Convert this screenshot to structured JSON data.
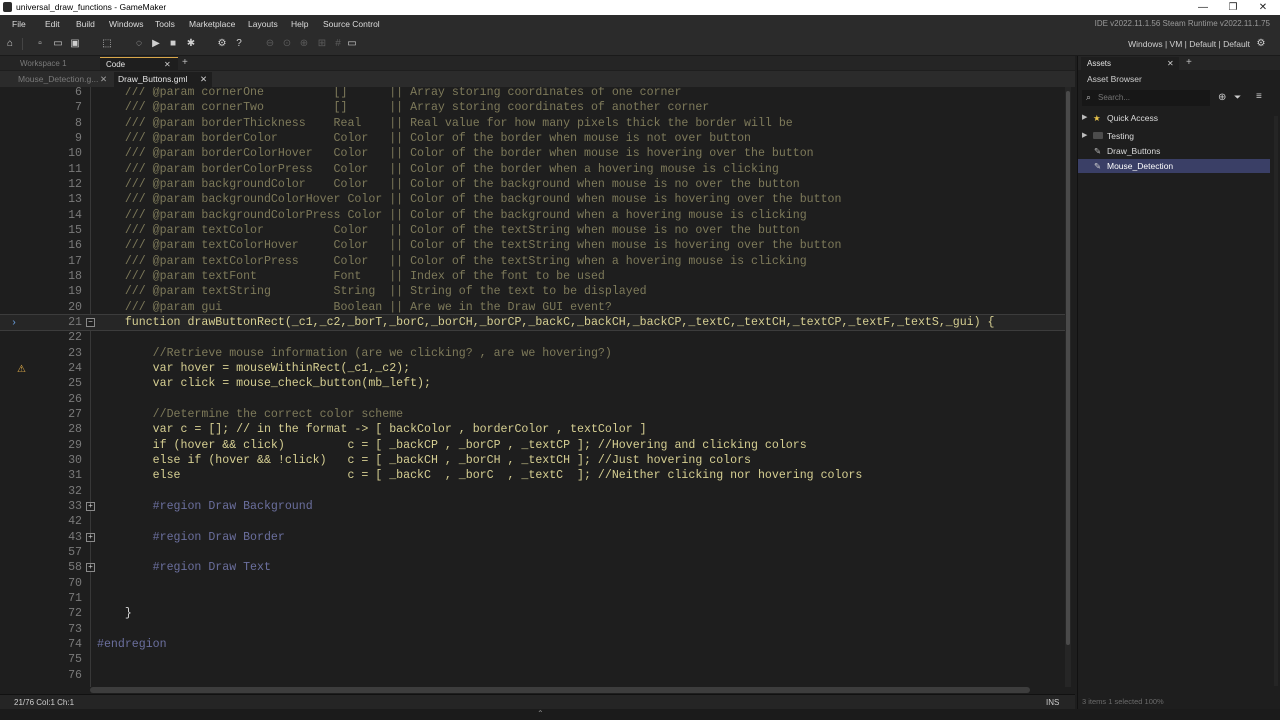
{
  "window": {
    "title": "universal_draw_functions - GameMaker",
    "controls": [
      "—",
      "❐",
      "✕"
    ]
  },
  "menu": {
    "items": [
      "File",
      "Edit",
      "Build",
      "Windows",
      "Tools",
      "Marketplace",
      "Layouts",
      "Help",
      "Source Control"
    ],
    "version_info": "IDE v2022.11.1.56 Steam  Runtime v2022.11.1.75"
  },
  "toolbar": {
    "target_info": "Windows | VM | Default | Default"
  },
  "workspace_tabs": [
    {
      "label": "Workspace 1",
      "active": false
    },
    {
      "label": "Code",
      "active": true
    }
  ],
  "doc_tabs": [
    {
      "label": "Mouse_Detection.g...",
      "active": false
    },
    {
      "label": "Draw_Buttons.gml",
      "active": true
    }
  ],
  "editor": {
    "colors": {
      "comment": "#7e7a5a",
      "keyword": "#d6cf92",
      "function": "#d6cf92",
      "builtin": "#d6cf92",
      "constant": "#d2706a",
      "region": "#6b6f9e",
      "text": "#d4d4d4",
      "warning": "#e8b24b"
    },
    "current_line": "21",
    "warning_line": "24",
    "lines": [
      {
        "num": "6",
        "text": "    /// @param cornerOne          []      || Array storing coordinates of one corner",
        "cls": "comment"
      },
      {
        "num": "7",
        "text": "    /// @param cornerTwo          []      || Array storing coordinates of another corner",
        "cls": "comment"
      },
      {
        "num": "8",
        "text": "    /// @param borderThickness    Real    || Real value for how many pixels thick the border will be",
        "cls": "comment"
      },
      {
        "num": "9",
        "text": "    /// @param borderColor        Color   || Color of the border when mouse is not over button",
        "cls": "comment"
      },
      {
        "num": "10",
        "text": "    /// @param borderColorHover   Color   || Color of the border when mouse is hovering over the button",
        "cls": "comment"
      },
      {
        "num": "11",
        "text": "    /// @param borderColorPress   Color   || Color of the border when a hovering mouse is clicking",
        "cls": "comment"
      },
      {
        "num": "12",
        "text": "    /// @param backgroundColor    Color   || Color of the background when mouse is no over the button",
        "cls": "comment"
      },
      {
        "num": "13",
        "text": "    /// @param backgroundColorHover Color || Color of the background when mouse is hovering over the button",
        "cls": "comment"
      },
      {
        "num": "14",
        "text": "    /// @param backgroundColorPress Color || Color of the background when a hovering mouse is clicking",
        "cls": "comment"
      },
      {
        "num": "15",
        "text": "    /// @param textColor          Color   || Color of the textString when mouse is no over the button",
        "cls": "comment"
      },
      {
        "num": "16",
        "text": "    /// @param textColorHover     Color   || Color of the textString when mouse is hovering over the button",
        "cls": "comment"
      },
      {
        "num": "17",
        "text": "    /// @param textColorPress     Color   || Color of the textString when a hovering mouse is clicking",
        "cls": "comment"
      },
      {
        "num": "18",
        "text": "    /// @param textFont           Font    || Index of the font to be used",
        "cls": "comment"
      },
      {
        "num": "19",
        "text": "    /// @param textString         String  || String of the text to be displayed",
        "cls": "comment"
      },
      {
        "num": "20",
        "text": "    /// @param gui                Boolean || Are we in the Draw GUI event?",
        "cls": "comment"
      },
      {
        "num": "21",
        "text": "    function drawButtonRect(_c1,_c2,_borT,_borC,_borCH,_borCP,_backC,_backCH,_backCP,_textC,_textCH,_textCP,_textF,_textS,_gui) {",
        "cls": "keyword"
      },
      {
        "num": "22",
        "text": "",
        "cls": "text"
      },
      {
        "num": "23",
        "text": "        //Retrieve mouse information (are we clicking? , are we hovering?)",
        "cls": "comment"
      },
      {
        "num": "24",
        "text": "        var hover = mouseWithinRect(_c1,_c2);",
        "cls": "keyword"
      },
      {
        "num": "25",
        "text": "        var click = mouse_check_button(mb_left);",
        "cls": "keyword"
      },
      {
        "num": "26",
        "text": "",
        "cls": "text"
      },
      {
        "num": "27",
        "text": "        //Determine the correct color scheme",
        "cls": "comment"
      },
      {
        "num": "28",
        "text": "        var c = []; // in the format -> [ backColor , borderColor , textColor ]",
        "cls": "keyword"
      },
      {
        "num": "29",
        "text": "        if (hover && click)         c = [ _backCP , _borCP , _textCP ]; //Hovering and clicking colors",
        "cls": "keyword"
      },
      {
        "num": "30",
        "text": "        else if (hover && !click)   c = [ _backCH , _borCH , _textCH ]; //Just hovering colors",
        "cls": "keyword"
      },
      {
        "num": "31",
        "text": "        else                        c = [ _backC  , _borC  , _textC  ]; //Neither clicking nor hovering colors",
        "cls": "keyword"
      },
      {
        "num": "32",
        "text": "",
        "cls": "text"
      },
      {
        "num": "33",
        "text": "        #region Draw Background",
        "cls": "region"
      },
      {
        "num": "42",
        "text": "",
        "cls": "text"
      },
      {
        "num": "43",
        "text": "        #region Draw Border",
        "cls": "region"
      },
      {
        "num": "57",
        "text": "",
        "cls": "text"
      },
      {
        "num": "58",
        "text": "        #region Draw Text",
        "cls": "region"
      },
      {
        "num": "70",
        "text": "",
        "cls": "text"
      },
      {
        "num": "71",
        "text": "",
        "cls": "text"
      },
      {
        "num": "72",
        "text": "    }",
        "cls": "text"
      },
      {
        "num": "73",
        "text": "",
        "cls": "text"
      },
      {
        "num": "74",
        "text": "#endregion",
        "cls": "region"
      },
      {
        "num": "75",
        "text": "",
        "cls": "text"
      },
      {
        "num": "76",
        "text": "",
        "cls": "text"
      }
    ]
  },
  "status": {
    "position": "21/76 Col:1 Ch:1",
    "mode": "INS"
  },
  "assets": {
    "tab_label": "Assets",
    "header": "Asset Browser",
    "search_placeholder": "Search...",
    "items": [
      {
        "label": "Quick Access",
        "type": "star",
        "selected": false
      },
      {
        "label": "Testing",
        "type": "folder",
        "selected": false
      },
      {
        "label": "Draw_Buttons",
        "type": "script",
        "selected": false
      },
      {
        "label": "Mouse_Detection",
        "type": "script",
        "selected": true
      }
    ],
    "footer": "3 items    1 selected            100%"
  }
}
